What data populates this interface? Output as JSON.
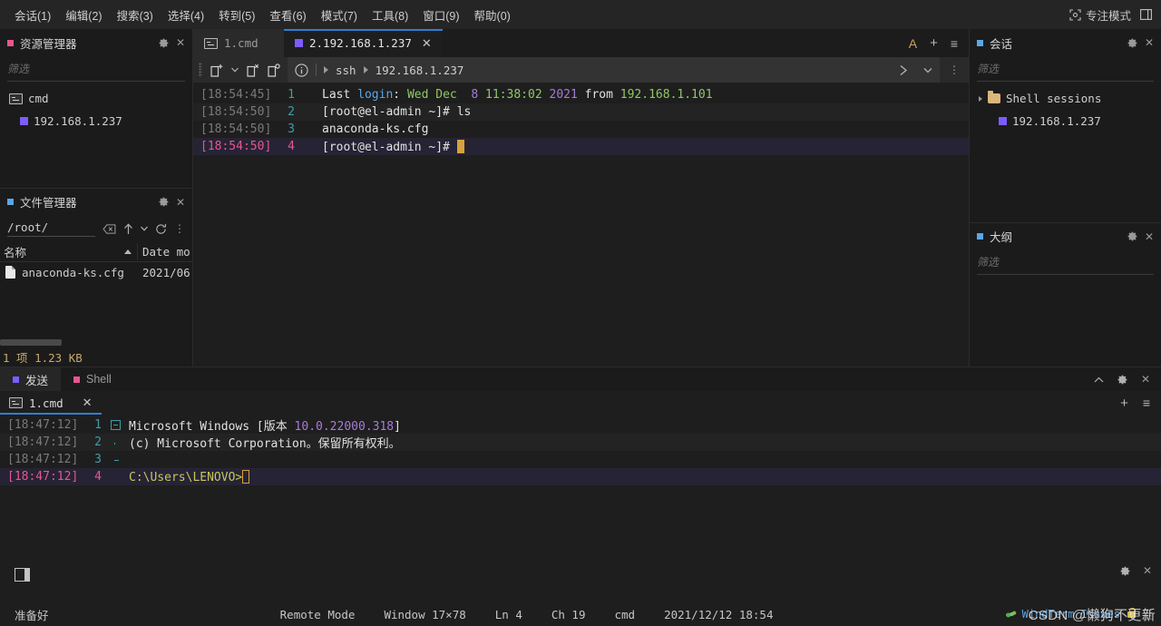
{
  "menubar": {
    "items": [
      {
        "label": "会话(1)"
      },
      {
        "label": "编辑(2)"
      },
      {
        "label": "搜索(3)"
      },
      {
        "label": "选择(4)"
      },
      {
        "label": "转到(5)"
      },
      {
        "label": "查看(6)"
      },
      {
        "label": "模式(7)"
      },
      {
        "label": "工具(8)"
      },
      {
        "label": "窗口(9)"
      },
      {
        "label": "帮助(0)"
      }
    ],
    "focus_mode_label": "专注模式",
    "focus_mode_icon": "focus-target-icon",
    "layout_icon": "layout-panel-icon"
  },
  "explorer": {
    "title": "资源管理器",
    "marker_color": "#e8568f",
    "filter_placeholder": "筛选",
    "items": [
      {
        "label": "cmd",
        "icon": "cmd-console-icon",
        "indent": 0
      },
      {
        "label": "192.168.1.237",
        "icon": "session-square-icon",
        "indent": 1,
        "color": "#7c5cff"
      }
    ],
    "gear_icon": "gear-icon",
    "close_icon": "close-icon"
  },
  "file_manager": {
    "title": "文件管理器",
    "marker_color": "#5aa7e8",
    "path": "/root/",
    "clear_icon": "backspace-icon",
    "up_icon": "arrow-up-icon",
    "dropdown_icon": "chevron-down-icon",
    "refresh_icon": "refresh-icon",
    "more_icon": "more-vertical-icon",
    "columns": [
      "名称",
      "Date mo"
    ],
    "rows": [
      {
        "name": "anaconda-ks.cfg",
        "date": "2021/06",
        "icon": "file-icon"
      }
    ],
    "status": "1 项 1.23 KB",
    "gear_icon": "gear-icon",
    "close_icon": "close-icon"
  },
  "editor": {
    "tabs": [
      {
        "label": "1.cmd",
        "icon": "cmd-console-icon",
        "active": false,
        "closable": false
      },
      {
        "label": "2.192.168.1.237",
        "icon": "session-square-icon",
        "marker_color": "#7c5cff",
        "active": true,
        "closable": true
      }
    ],
    "tabbar_actions": [
      {
        "name": "font-size-icon",
        "glyph": "A"
      },
      {
        "name": "add-tab-icon",
        "glyph": "+"
      },
      {
        "name": "tab-menu-icon",
        "glyph": "≡"
      }
    ],
    "toolbar": {
      "grip_icon": "drag-grip-icon",
      "new_session_icon": "new-session-icon",
      "new_session_dropdown_icon": "chevron-down-icon",
      "close_session_icon": "close-session-icon",
      "reconnect_session_icon": "reconnect-session-icon",
      "info_icon": "info-icon",
      "breadcrumb": [
        "ssh",
        "192.168.1.237"
      ],
      "run_icon": "chevron-right-icon",
      "history_icon": "chevron-down-icon",
      "more_icon": "more-vertical-icon"
    },
    "terminal": {
      "lines": [
        {
          "timestamp": "[18:54:45]",
          "number": "1",
          "current": false,
          "spans": [
            {
              "text": "Last ",
              "color": "white"
            },
            {
              "text": "login",
              "color": "blue"
            },
            {
              "text": ": ",
              "color": "white"
            },
            {
              "text": "Wed Dec",
              "color": "green"
            },
            {
              "text": "  ",
              "color": "white"
            },
            {
              "text": "8",
              "color": "purple"
            },
            {
              "text": " ",
              "color": "white"
            },
            {
              "text": "11:38:02",
              "color": "green"
            },
            {
              "text": " ",
              "color": "white"
            },
            {
              "text": "2021",
              "color": "purple"
            },
            {
              "text": " from ",
              "color": "white"
            },
            {
              "text": "192.168.1.101",
              "color": "green"
            }
          ]
        },
        {
          "timestamp": "[18:54:50]",
          "number": "2",
          "current": false,
          "spans": [
            {
              "text": "[root@el-admin ~]# ls",
              "color": "white"
            }
          ]
        },
        {
          "timestamp": "[18:54:50]",
          "number": "3",
          "current": false,
          "spans": [
            {
              "text": "anaconda-ks.cfg",
              "color": "white"
            }
          ]
        },
        {
          "timestamp": "[18:54:50]",
          "number": "4",
          "current": true,
          "cursor": "block",
          "spans": [
            {
              "text": "[root@el-admin ~]# ",
              "color": "white"
            }
          ]
        }
      ]
    }
  },
  "sessions_panel": {
    "title": "会话",
    "marker_color": "#5aa7e8",
    "filter_placeholder": "筛选",
    "items": [
      {
        "label": "Shell sessions",
        "icon": "folder-icon",
        "expander": "caret-right-icon",
        "indent": 0
      },
      {
        "label": "192.168.1.237",
        "icon": "session-square-icon",
        "color": "#7c5cff",
        "indent": 1
      }
    ],
    "gear_icon": "gear-icon",
    "close_icon": "close-icon"
  },
  "outline_panel": {
    "title": "大纲",
    "marker_color": "#5aa7e8",
    "filter_placeholder": "筛选",
    "gear_icon": "gear-icon",
    "close_icon": "close-icon"
  },
  "bottom_dock": {
    "tabs": [
      {
        "label": "发送",
        "marker_color": "#7c5cff",
        "active": true
      },
      {
        "label": "Shell",
        "marker_color": "#e8568f",
        "active": false
      }
    ],
    "header_actions": [
      {
        "name": "collapse-icon",
        "glyph": "⌃"
      },
      {
        "name": "gear-icon",
        "glyph": "✿"
      },
      {
        "name": "close-icon",
        "glyph": "✕"
      }
    ],
    "subtabs": [
      {
        "label": "1.cmd",
        "icon": "cmd-console-icon",
        "active": true,
        "closable": true
      }
    ],
    "subtab_actions": [
      {
        "name": "add-tab-icon",
        "glyph": "+"
      },
      {
        "name": "tab-menu-icon",
        "glyph": "≡"
      }
    ],
    "terminal": {
      "lines": [
        {
          "timestamp": "[18:47:12]",
          "number": "1",
          "fold": "start",
          "current": false,
          "spans": [
            {
              "text": "Microsoft Windows [版本 ",
              "color": "white"
            },
            {
              "text": "10.0.22000.318",
              "color": "purple"
            },
            {
              "text": "]",
              "color": "white"
            }
          ]
        },
        {
          "timestamp": "[18:47:12]",
          "number": "2",
          "fold": "mid",
          "current": false,
          "spans": [
            {
              "text": "(c) Microsoft Corporation。保留所有权利。",
              "color": "white"
            }
          ]
        },
        {
          "timestamp": "[18:47:12]",
          "number": "3",
          "fold": "end",
          "current": false,
          "spans": [
            {
              "text": "",
              "color": "white"
            }
          ]
        },
        {
          "timestamp": "[18:47:12]",
          "number": "4",
          "fold": "none",
          "current": true,
          "cursor": "hollow",
          "spans": [
            {
              "text": "C:\\Users\\LENOVO>",
              "color": "ylw"
            }
          ]
        }
      ]
    }
  },
  "statusbar": {
    "ready_label": "准备好",
    "panel_icon": "panel-layout-icon",
    "strip_actions": [
      {
        "name": "gear-icon",
        "glyph": "✿"
      },
      {
        "name": "close-icon",
        "glyph": "✕"
      }
    ],
    "remote_mode": "Remote Mode",
    "window_size": "Window 17×78",
    "line": "Ln 4",
    "column": "Ch 19",
    "shell": "cmd",
    "datetime": "2021/12/12 18:54",
    "issues_label": "WindTerm Issues",
    "issues_icon": "bug-icon",
    "lock_icon": "lock-icon",
    "grip_icon": "resize-grip-icon"
  },
  "watermark": {
    "line1": "CSDN @懒狗不更新"
  }
}
